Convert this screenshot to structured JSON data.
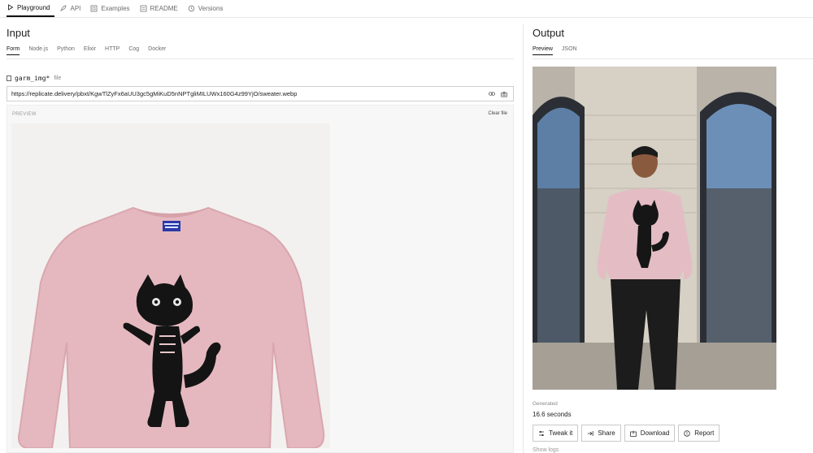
{
  "nav": {
    "tabs": [
      {
        "label": "Playground",
        "icon": "play-icon"
      },
      {
        "label": "API",
        "icon": "rocket-icon"
      },
      {
        "label": "Examples",
        "icon": "examples-icon"
      },
      {
        "label": "README",
        "icon": "readme-icon"
      },
      {
        "label": "Versions",
        "icon": "history-icon"
      }
    ]
  },
  "input": {
    "title": "Input",
    "tabs": [
      "Form",
      "Node.js",
      "Python",
      "Elixir",
      "HTTP",
      "Cog",
      "Docker"
    ],
    "field": {
      "name": "garm_img*",
      "type": "file",
      "value": "https://replicate.delivery/pbxt/KgwTlZyFx6aUU3gc5gMiKuD5nNPTgliMILUWx160G4z99YjO/sweater.webp"
    },
    "preview_label": "PREVIEW",
    "clear_label": "Clear file"
  },
  "output": {
    "title": "Output",
    "tabs": [
      "Preview",
      "JSON"
    ],
    "generated_label": "Generated",
    "generated_value": "16.6 seconds",
    "actions": [
      {
        "label": "Tweak it",
        "icon": "tweak-icon"
      },
      {
        "label": "Share",
        "icon": "share-icon"
      },
      {
        "label": "Download",
        "icon": "download-icon"
      },
      {
        "label": "Report",
        "icon": "report-icon"
      }
    ],
    "more_label": "Show logs"
  }
}
